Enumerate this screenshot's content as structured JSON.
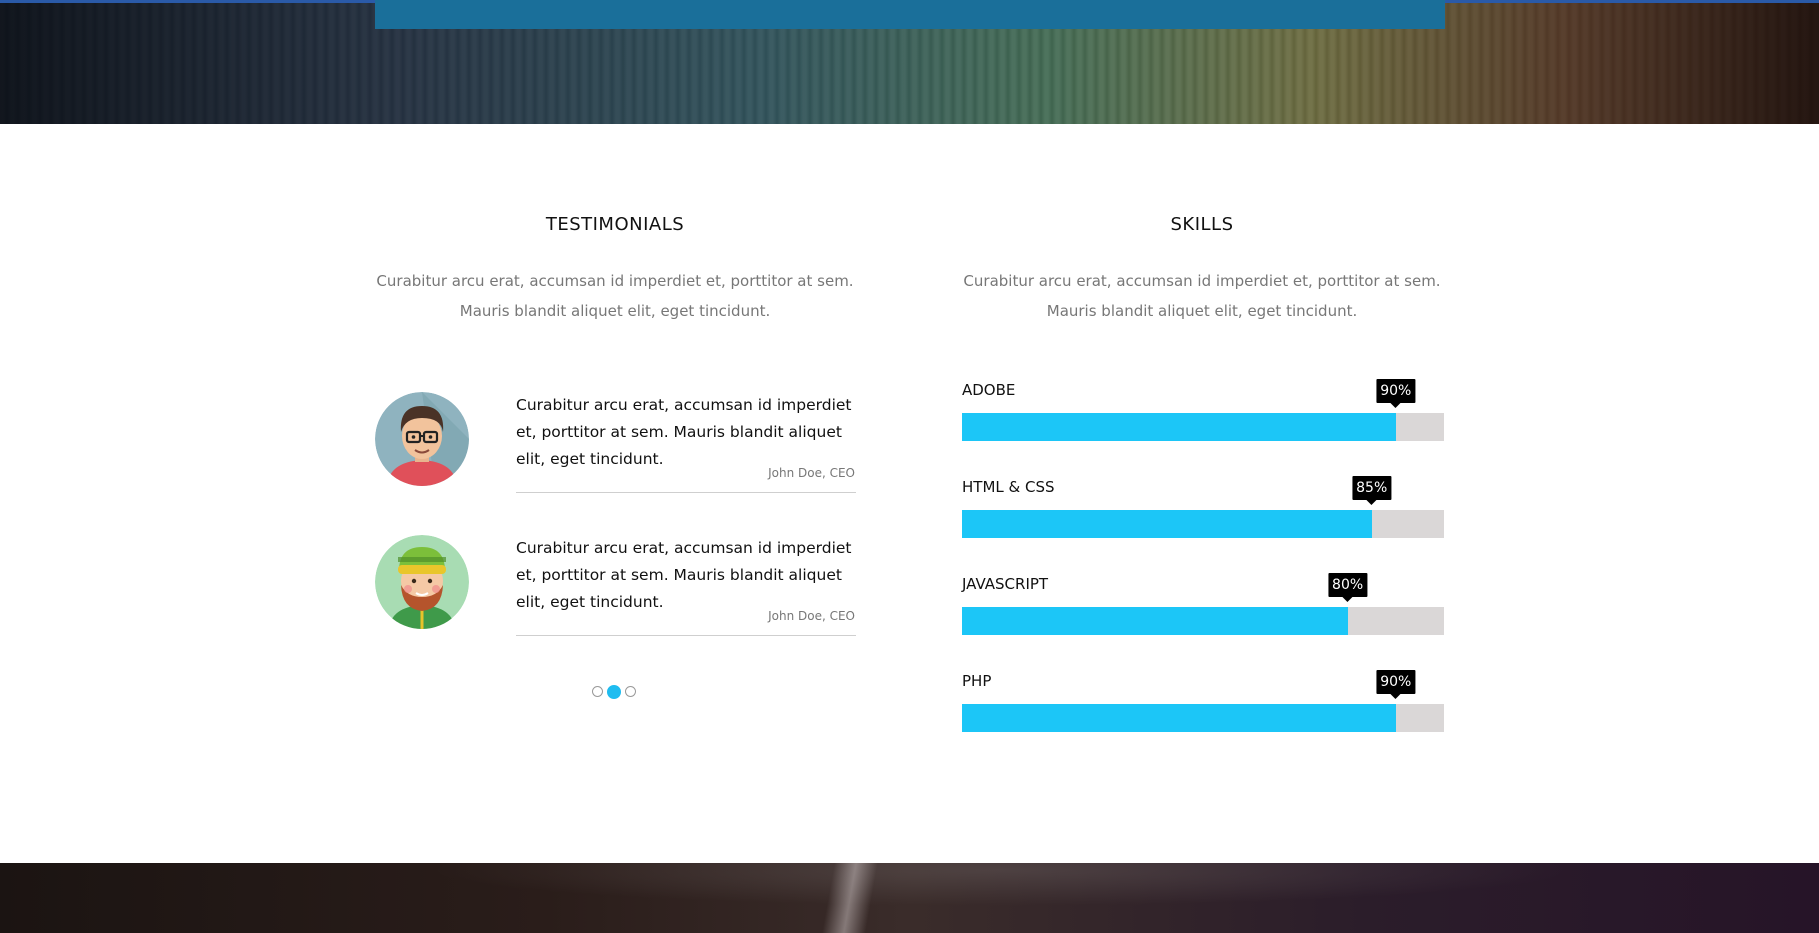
{
  "testimonials": {
    "title": "TESTIMONIALS",
    "description_line1": "Curabitur arcu erat, accumsan id imperdiet et, porttitor at sem.",
    "description_line2": "Mauris blandit aliquet elit, eget tincidunt.",
    "items": [
      {
        "quote": "Curabitur arcu erat, accumsan id imperdiet et, porttitor at sem. Mauris blandit aliquet elit, eget tincidunt.",
        "author": "John Doe, CEO",
        "avatar_icon": "man-with-glasses-avatar-icon"
      },
      {
        "quote": "Curabitur arcu erat, accumsan id imperdiet et, porttitor at sem. Mauris blandit aliquet elit, eget tincidunt.",
        "author": "John Doe, CEO",
        "avatar_icon": "bearded-man-with-beanie-avatar-icon"
      }
    ],
    "pagination": {
      "count": 3,
      "active_index": 1
    }
  },
  "skills": {
    "title": "SKILLS",
    "description_line1": "Curabitur arcu erat, accumsan id imperdiet et, porttitor at sem.",
    "description_line2": "Mauris blandit aliquet elit, eget tincidunt.",
    "items": [
      {
        "label": "ADOBE",
        "percent_text": "90%",
        "percent": 90
      },
      {
        "label": "HTML & CSS",
        "percent_text": "85%",
        "percent": 85
      },
      {
        "label": "JAVASCRIPT",
        "percent_text": "80%",
        "percent": 80
      },
      {
        "label": "PHP",
        "percent_text": "90%",
        "percent": 90
      }
    ]
  },
  "colors": {
    "accent": "#1cc6f7",
    "track": "#dad7d7",
    "tooltip": "#000000",
    "banner_bar": "#1a6f9a"
  }
}
